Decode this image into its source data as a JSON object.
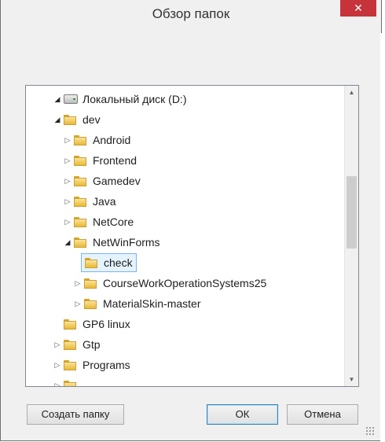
{
  "window": {
    "title": "Обзор папок",
    "close_symbol": "✕"
  },
  "tree": {
    "items": [
      {
        "label": "Локальный диск (D:)",
        "expander": "◢",
        "icon": "drive-icon"
      },
      {
        "label": "dev",
        "expander": "◢",
        "icon": "folder-icon"
      },
      {
        "label": "Android",
        "expander": "▷",
        "icon": "folder-icon"
      },
      {
        "label": "Frontend",
        "expander": "▷",
        "icon": "folder-icon"
      },
      {
        "label": "Gamedev",
        "expander": "▷",
        "icon": "folder-icon"
      },
      {
        "label": "Java",
        "expander": "▷",
        "icon": "folder-icon"
      },
      {
        "label": "NetCore",
        "expander": "▷",
        "icon": "folder-icon"
      },
      {
        "label": "NetWinForms",
        "expander": "◢",
        "icon": "folder-icon"
      },
      {
        "label": "check",
        "expander": "",
        "icon": "folder-icon",
        "selected": true
      },
      {
        "label": "CourseWorkOperationSystems25",
        "expander": "▷",
        "icon": "folder-icon"
      },
      {
        "label": "MaterialSkin-master",
        "expander": "▷",
        "icon": "folder-icon"
      },
      {
        "label": "GP6 linux",
        "expander": "",
        "icon": "folder-icon"
      },
      {
        "label": "Gtp",
        "expander": "▷",
        "icon": "folder-icon"
      },
      {
        "label": "Programs",
        "expander": "▷",
        "icon": "folder-icon"
      }
    ],
    "scroll_up_symbol": "▲",
    "scroll_down_symbol": "▼"
  },
  "buttons": {
    "new_folder": "Создать папку",
    "ok": "ОК",
    "cancel": "Отмена"
  },
  "colors": {
    "close": "#c7333b",
    "selection": "#e5f3ff",
    "selection_border": "#7eb4ea"
  }
}
